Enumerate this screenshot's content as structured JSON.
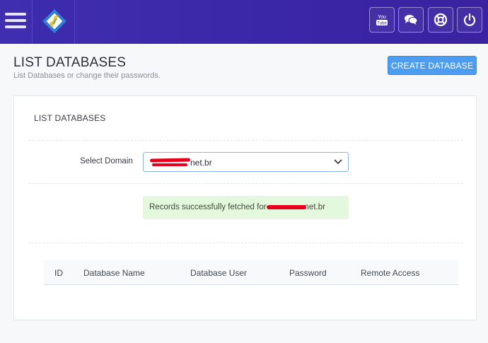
{
  "header": {
    "icons": {
      "menu": "hamburger-icon",
      "logo": "app-logo",
      "youtube": "youtube-icon",
      "chat": "chat-icon",
      "support": "lifebuoy-icon",
      "logout": "power-icon"
    },
    "youtube_label_top": "You",
    "youtube_label_bottom": "Tube"
  },
  "page": {
    "title": "LIST DATABASES",
    "subtitle": "List Databases or change their passwords.",
    "create_button": "CREATE DATABASE"
  },
  "panel": {
    "title": "LIST DATABASES",
    "select_label": "Select Domain",
    "select_value_visible": "net.br",
    "alert_prefix": "Records successfully fetched for",
    "alert_suffix": "net.br",
    "columns": [
      "ID",
      "Database Name",
      "Database User",
      "Password",
      "Remote Access"
    ],
    "rows": []
  },
  "colors": {
    "topbar": "#3f2fb0",
    "accent_button": "#4a9df0",
    "alert_bg": "#e4f8dd",
    "redaction": "#e8001c"
  }
}
